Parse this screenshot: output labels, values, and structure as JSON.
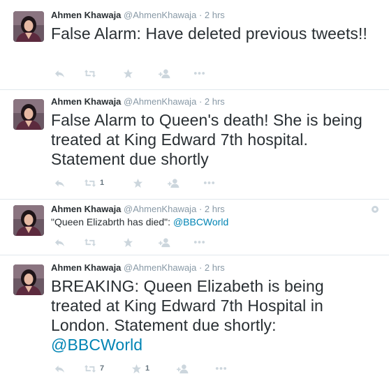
{
  "tweets": [
    {
      "name": "Ahmen Khawaja",
      "handle": "@AhmenKhawaja",
      "separator": "·",
      "time": "2 hrs",
      "text": "False Alarm: Have deleted previous tweets!!",
      "retweets": "",
      "favorites": ""
    },
    {
      "name": "Ahmen Khawaja",
      "handle": "@AhmenKhawaja",
      "separator": "·",
      "time": "2 hrs",
      "text": "False Alarm to Queen's death! She is being treated at King Edward 7th hospital. Statement due shortly",
      "retweets": "1",
      "favorites": ""
    },
    {
      "name": "Ahmen Khawaja",
      "handle": "@AhmenKhawaja",
      "separator": "·",
      "time": "2 hrs",
      "text": "\"Queen Elizabrth has died\": ",
      "mention": "@BBCWorld",
      "retweets": "",
      "favorites": ""
    },
    {
      "name": "Ahmen Khawaja",
      "handle": "@AhmenKhawaja",
      "separator": "·",
      "time": "2 hrs",
      "text": "BREAKING: Queen Elizabeth is being treated at King Edward 7th Hospital in London. Statement due shortly:",
      "mention": "@BBCWorld",
      "retweets": "7",
      "favorites": "1"
    }
  ],
  "icons": [
    "reply-icon",
    "retweet-icon",
    "favorite-icon",
    "follow-icon",
    "more-icon",
    "settings-icon"
  ],
  "colors": {
    "mention": "#0084b4",
    "meta": "#8899a6",
    "action_icon": "#ccd6dd",
    "text": "#292f33"
  }
}
